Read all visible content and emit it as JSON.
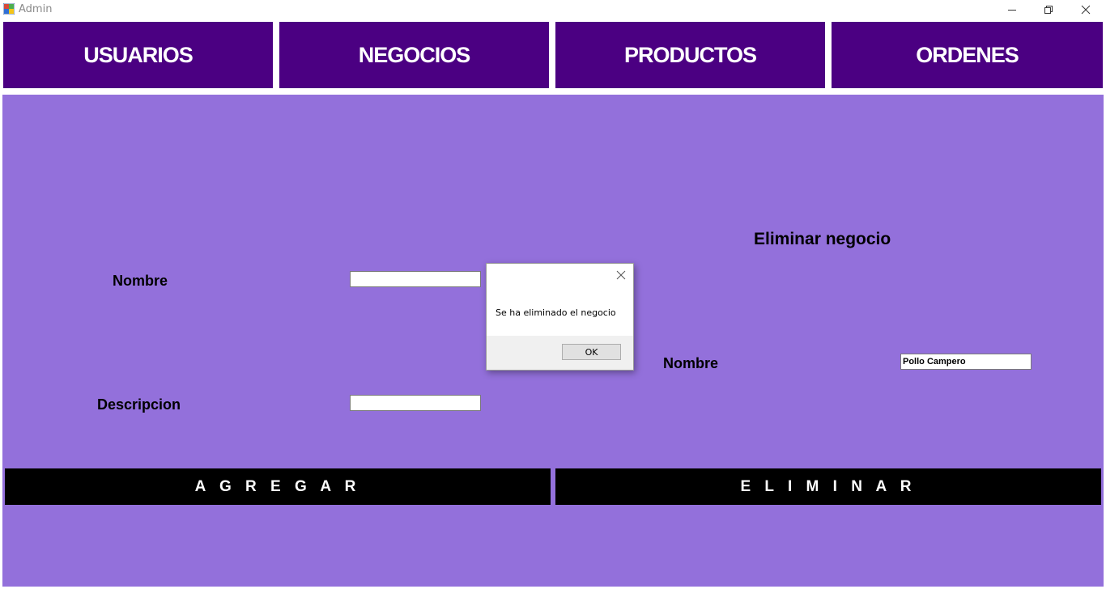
{
  "window": {
    "title": "Admin",
    "icon": "app-icon",
    "controls": [
      "minimize-icon",
      "restore-icon",
      "close-icon"
    ]
  },
  "nav": {
    "usuarios": "USUARIOS",
    "negocios": "NEGOCIOS",
    "productos": "PRODUCTOS",
    "ordenes": "ORDENES"
  },
  "add_form": {
    "nombre_label": "Nombre",
    "nombre_value": "",
    "descripcion_label": "Descripcion",
    "descripcion_value": "",
    "submit_label": "A G R E G A R"
  },
  "delete_form": {
    "title": "Eliminar negocio",
    "nombre_label": "Nombre",
    "nombre_value": "Pollo Campero",
    "submit_label": "E L I M I N A R"
  },
  "dialog": {
    "message": "Se ha eliminado el negocio",
    "ok_label": "OK"
  },
  "colors": {
    "nav_bg": "#4b0082",
    "panel_bg": "#9370db",
    "button_bg": "#000000"
  }
}
